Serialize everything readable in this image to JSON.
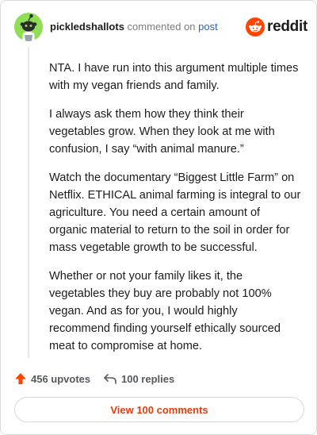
{
  "header": {
    "username": "pickledshallots",
    "verb": "commented on",
    "post_link": "post",
    "brand": "reddit"
  },
  "comment": {
    "paragraphs": [
      "NTA. I have run into this argument multiple times with my vegan friends and family.",
      "I always ask them how they think their vegetables grow. When they look at me with confusion, I say “with animal manure.”",
      "Watch the documentary “Biggest Little Farm” on Netflix. ETHICAL animal farming is integral to our agriculture. You need a certain amount of organic material to return to the soil in order for mass vegetable growth to be successful.",
      "Whether or not your family likes it, the vegetables they buy are probably not 100% vegan. And as for you, I would highly recommend finding yourself ethically sourced meat to compromise at home."
    ]
  },
  "actions": {
    "upvotes": "456 upvotes",
    "replies": "100 replies"
  },
  "view_comments": "View 100 comments",
  "colors": {
    "accent": "#ff4500",
    "link": "#2a65b3",
    "avatar_bg": "#8fde55",
    "view_button_text": "#e03d0f"
  },
  "icons": {
    "avatar": "snoo-avatar-icon",
    "brand": "reddit-logo-icon",
    "upvote": "upvote-arrow-icon",
    "reply": "reply-arrow-icon"
  }
}
